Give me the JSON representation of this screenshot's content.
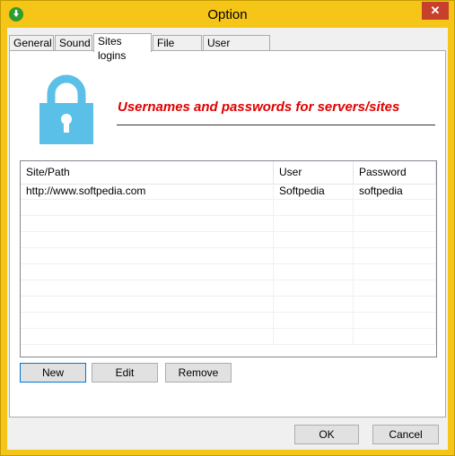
{
  "window": {
    "title": "Option"
  },
  "tabs": [
    {
      "label": "General"
    },
    {
      "label": "Sound"
    },
    {
      "label": "Sites logins"
    },
    {
      "label": "File types"
    },
    {
      "label": "User interface"
    }
  ],
  "panel": {
    "heading": "Usernames and passwords for servers/sites"
  },
  "table": {
    "columns": [
      "Site/Path",
      "User",
      "Password"
    ],
    "rows": [
      {
        "site": "http://www.softpedia.com",
        "user": "Softpedia",
        "password": "softpedia"
      }
    ]
  },
  "actions": {
    "new_label": "New",
    "edit_label": "Edit",
    "remove_label": "Remove"
  },
  "footer": {
    "ok_label": "OK",
    "cancel_label": "Cancel"
  },
  "colors": {
    "accent": "#5bc0e8",
    "heading": "#e00000",
    "frame": "#f5c518",
    "close": "#c7402c"
  },
  "icons": {
    "app": "download-arrow-icon",
    "close": "close-icon",
    "lock": "lock-icon"
  }
}
